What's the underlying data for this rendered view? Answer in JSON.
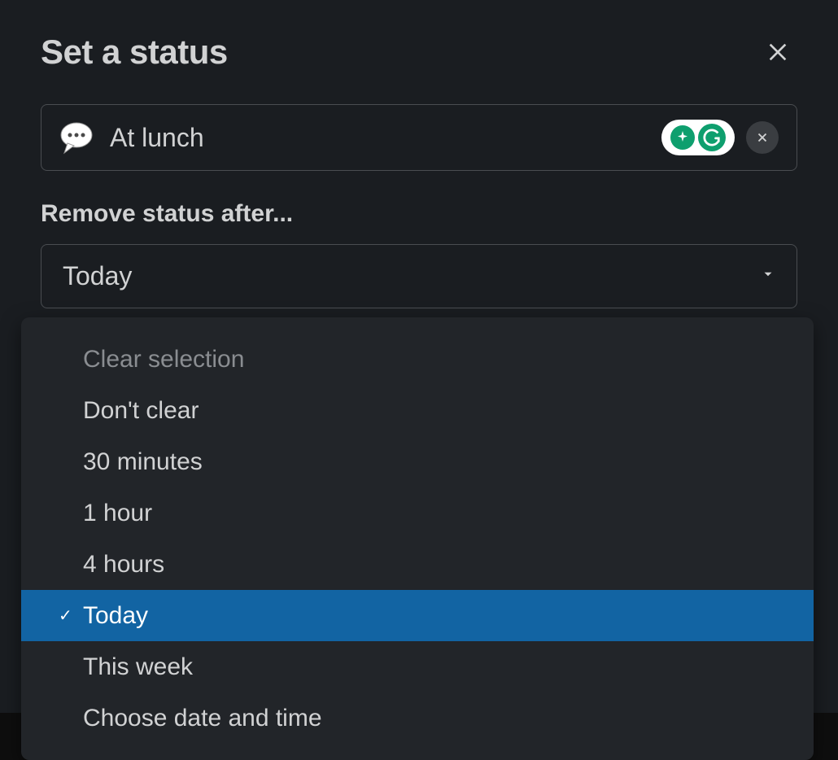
{
  "modal": {
    "title": "Set a status"
  },
  "status": {
    "text": "At lunch",
    "emoji_name": "speech-balloon"
  },
  "remove_after": {
    "label": "Remove status after...",
    "selected": "Today"
  },
  "dropdown": {
    "items": [
      {
        "label": "Clear selection",
        "disabled": true,
        "selected": false
      },
      {
        "label": "Don't clear",
        "disabled": false,
        "selected": false
      },
      {
        "label": "30 minutes",
        "disabled": false,
        "selected": false
      },
      {
        "label": "1 hour",
        "disabled": false,
        "selected": false
      },
      {
        "label": "4 hours",
        "disabled": false,
        "selected": false
      },
      {
        "label": "Today",
        "disabled": false,
        "selected": true
      },
      {
        "label": "This week",
        "disabled": false,
        "selected": false
      },
      {
        "label": "Choose date and time",
        "disabled": false,
        "selected": false
      }
    ]
  }
}
